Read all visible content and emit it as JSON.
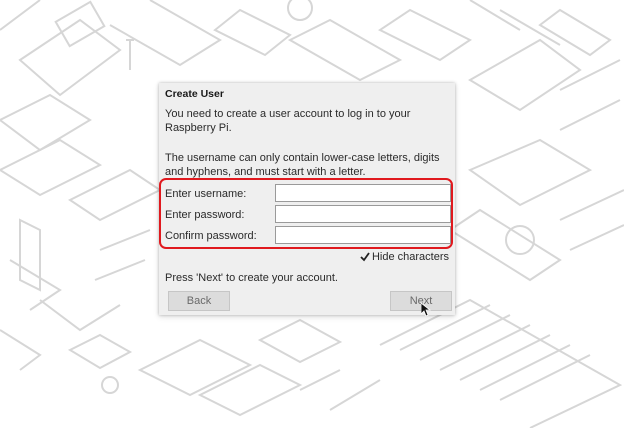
{
  "dialog": {
    "title": "Create User",
    "intro": "You need to create a user account to log in to your Raspberry Pi.",
    "rules": "The username can only contain lower-case letters, digits and hyphens, and must start with a letter.",
    "fields": [
      {
        "label": "Enter username:",
        "value": ""
      },
      {
        "label": "Enter password:",
        "value": ""
      },
      {
        "label": "Confirm password:",
        "value": ""
      }
    ],
    "hide_characters": {
      "label": "Hide characters",
      "checked": true
    },
    "instruction": "Press 'Next' to create your account.",
    "back_label": "Back",
    "next_label": "Next"
  },
  "colors": {
    "highlight": "#e0191e",
    "background_lines": "#d8d8d8",
    "dialog_bg": "#efefef"
  }
}
